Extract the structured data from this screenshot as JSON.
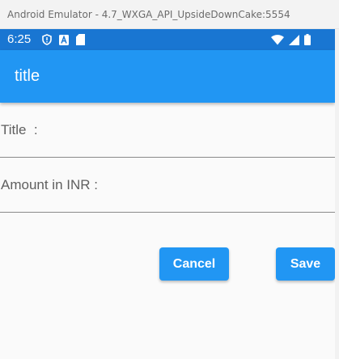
{
  "window": {
    "title": "Android Emulator - 4.7_WXGA_API_UpsideDownCake:5554"
  },
  "status_bar": {
    "time": "6:25",
    "left_icons": [
      "shield-icon",
      "a-icon",
      "sd-card-icon"
    ],
    "right_icons": [
      "wifi-icon",
      "signal-icon",
      "battery-icon"
    ],
    "color": "#1976d2"
  },
  "app_bar": {
    "title": "title",
    "color": "#2196f3"
  },
  "form": {
    "title_field": {
      "label": "Title  :",
      "value": ""
    },
    "amount_field": {
      "label": "Amount in INR :",
      "value": ""
    }
  },
  "buttons": {
    "cancel_label": "Cancel",
    "save_label": "Save",
    "color": "#2196f3"
  }
}
